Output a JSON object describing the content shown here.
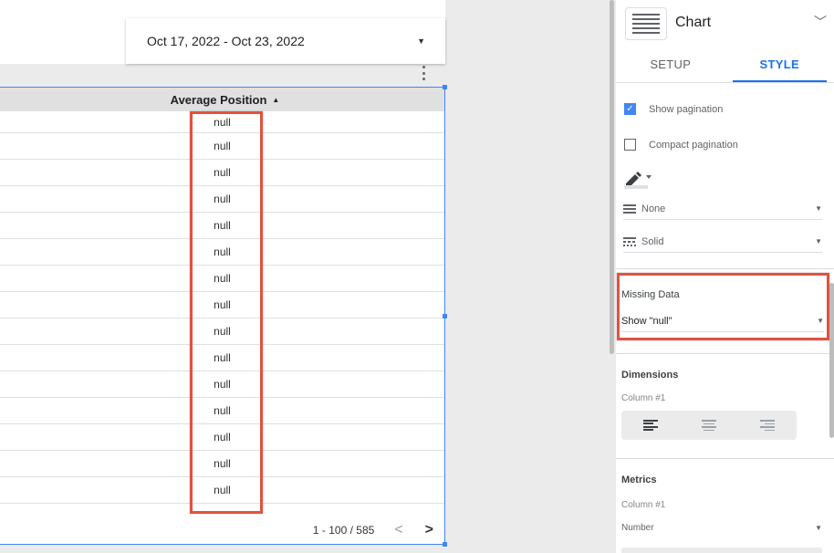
{
  "date_range": {
    "label": "Oct 17, 2022 - Oct 23, 2022"
  },
  "table": {
    "column_header": "Average Position",
    "sort_indicator": "▲",
    "rows": [
      "null",
      "null",
      "null",
      "null",
      "null",
      "null",
      "null",
      "null",
      "null",
      "null",
      "null",
      "null",
      "null",
      "null",
      "null"
    ],
    "pagination": {
      "range": "1 - 100 / 585",
      "prev": "<",
      "next": ">"
    }
  },
  "panel": {
    "title": "Chart",
    "tabs": [
      {
        "label": "SETUP",
        "active": false
      },
      {
        "label": "STYLE",
        "active": true
      }
    ],
    "show_pagination": {
      "label": "Show pagination",
      "checked": true
    },
    "compact_pagination": {
      "label": "Compact pagination",
      "checked": false
    },
    "border_style": "None",
    "line_style": "Solid",
    "missing_data": {
      "label": "Missing Data",
      "value": "Show \"null\""
    },
    "dimensions": {
      "label": "Dimensions",
      "column": "Column #1"
    },
    "metrics": {
      "label": "Metrics",
      "column": "Column #1",
      "format": "Number"
    }
  },
  "colors": {
    "accent": "#1a73e8",
    "highlight": "#e0533f",
    "selection": "#4285f4"
  }
}
